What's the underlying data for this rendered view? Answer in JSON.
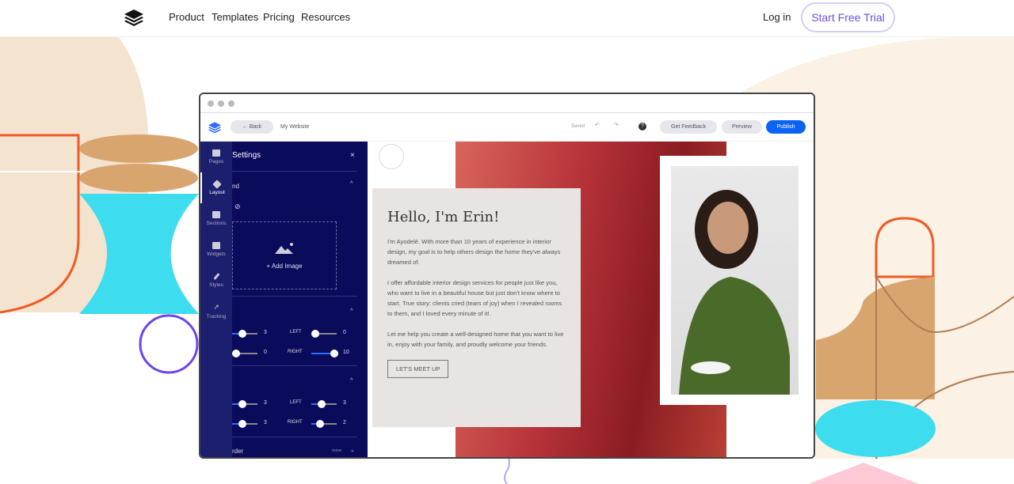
{
  "nav": {
    "links": [
      "Product",
      "Templates",
      "Pricing",
      "Resources"
    ],
    "login": "Log in",
    "cta": "Start Free Trial"
  },
  "editor": {
    "back": "Back",
    "site_name": "My Website",
    "saved": "Saved",
    "get_feedback": "Get Feedback",
    "preview": "Preview",
    "publish": "Publish",
    "rail": [
      "Pages",
      "Layout",
      "Sections",
      "Widgets",
      "Styles",
      "Tracking"
    ],
    "panel": {
      "title": "Settings",
      "section1": "nd",
      "add_image": "+ Add Image",
      "sliders1": {
        "a": "3",
        "b": "0",
        "left_label": "LEFT",
        "left": "0",
        "right_label": "RIGHT",
        "right": "10"
      },
      "sliders2": {
        "a": "3",
        "b": "3",
        "left_label": "LEFT",
        "left": "3",
        "right_label": "RIGHT",
        "right": "2"
      },
      "border_label": "rder",
      "border_value": "none"
    }
  },
  "site": {
    "heading": "Hello, I'm Erin!",
    "p1": "I'm Ayodelé. With more than 10 years of experience in interior design, my goal is to help others design the home they've always dreamed of.",
    "p2": "I offer affordable interior design services for people just like you, who want to live in a beautiful house but just don't know where to start. True story: clients cried (tears of joy) when I revealed rooms to them, and I loved every minute of it!.",
    "p3": "Let me help you create a well-designed home that you want to live in, enjoy with your family, and proudly welcome your friends.",
    "cta": "LET'S MEET UP"
  },
  "colors": {
    "accent": "#6a4de6",
    "publish": "#0b63f6",
    "panel": "#0b0b5c",
    "rail": "#1c1f6e"
  }
}
